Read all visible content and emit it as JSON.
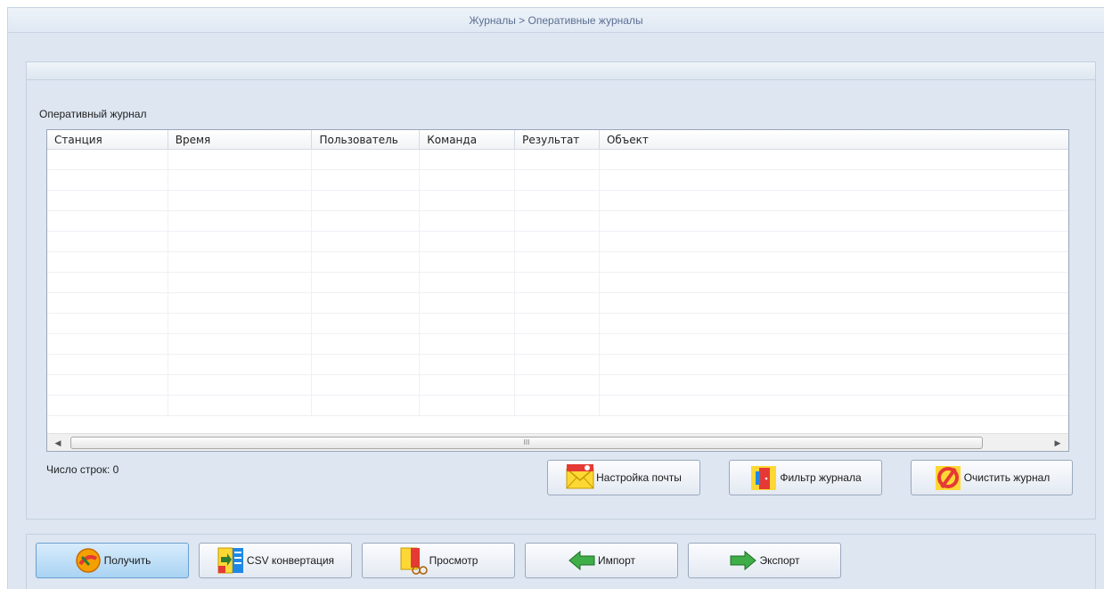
{
  "window": {
    "breadcrumb": "Журналы > Оперативные журналы"
  },
  "journal": {
    "group_label": "Оперативный журнал",
    "columns": [
      "Станция",
      "Время",
      "Пользователь",
      "Команда",
      "Результат",
      "Объект"
    ],
    "rows": [],
    "scroll_mark": "III",
    "row_count_label": "Число строк: 0"
  },
  "actions": {
    "mail_settings": "Настройка почты",
    "journal_filter": "Фильтр журнала",
    "clear_journal": "Очистить журнал"
  },
  "toolbar": {
    "get": "Получить",
    "csv": "CSV конвертация",
    "view": "Просмотр",
    "import": "Импорт",
    "export": "Экспорт"
  },
  "icons": {
    "get": "retrieve-icon",
    "csv": "csv-convert-icon",
    "view": "preview-icon",
    "import": "import-arrow-icon",
    "export": "export-arrow-icon",
    "mail": "mail-settings-icon",
    "filter": "filter-door-icon",
    "clear": "clear-forbidden-icon"
  },
  "colors": {
    "background": "#dde6f1",
    "active_button": "#a9d3f3",
    "arrow_green": "#3fae49"
  }
}
